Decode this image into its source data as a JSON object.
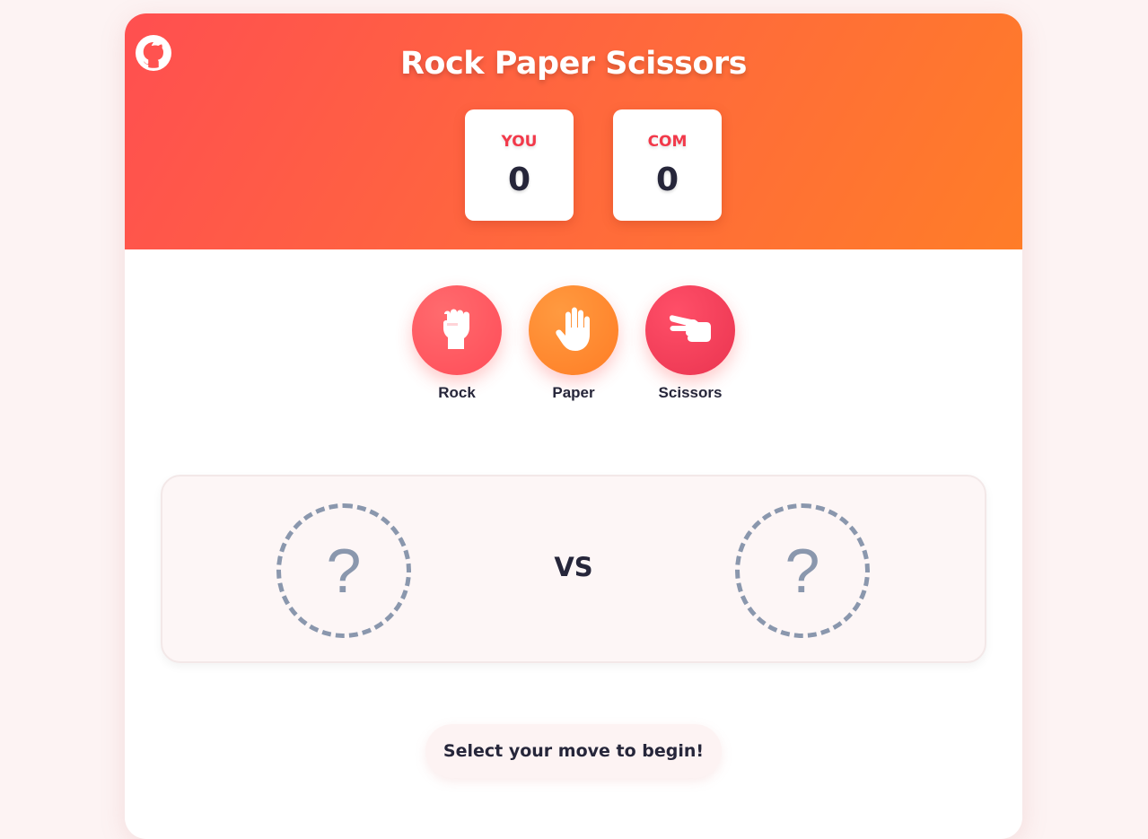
{
  "header": {
    "title": "Rock Paper Scissors",
    "github_icon": "github-icon"
  },
  "scores": {
    "you": {
      "label": "YOU",
      "value": "0"
    },
    "com": {
      "label": "COM",
      "value": "0"
    }
  },
  "moves": [
    {
      "label": "Rock",
      "icon": "fist-icon",
      "color": "#ff5560"
    },
    {
      "label": "Paper",
      "icon": "open-hand-icon",
      "color": "#ff8a2e"
    },
    {
      "label": "Scissors",
      "icon": "scissors-hand-icon",
      "color": "#f23f5c"
    }
  ],
  "arena": {
    "player_placeholder": "?",
    "vs_label": "VS",
    "computer_placeholder": "?"
  },
  "status": {
    "message": "Select your move to begin!"
  },
  "colors": {
    "accent_red": "#f2394a",
    "header_gradient_start": "#ff4f50",
    "header_gradient_end": "#ff7d28",
    "text_dark": "#26263a",
    "placeholder_gray": "#8a97ad"
  }
}
